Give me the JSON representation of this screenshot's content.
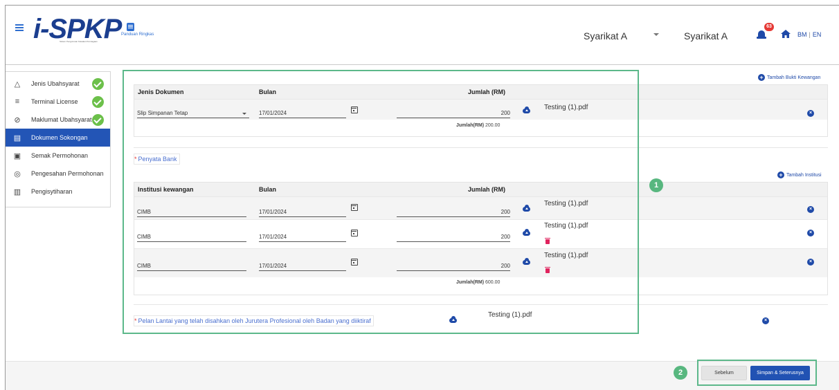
{
  "header": {
    "logo_text": "i-SPKP",
    "logo_subtitle": "Sistem Pengurusan Kawalan Perniagaan",
    "guide_label": "Panduan Ringkas",
    "company_primary": "Syarikat A",
    "company_secondary": "Syarikat A",
    "notification_count": "63",
    "lang_bm": "BM",
    "lang_sep": "|",
    "lang_en": "EN"
  },
  "sidebar": {
    "items": [
      {
        "label": "Jenis Ubahsyarat",
        "icon": "triangle-icon",
        "completed": true
      },
      {
        "label": "Terminal License",
        "icon": "filter-icon",
        "completed": true
      },
      {
        "label": "Maklumat Ubahsyarat",
        "icon": "check-circle-icon",
        "completed": true
      },
      {
        "label": "Dokumen Sokongan",
        "icon": "document-icon",
        "active": true
      },
      {
        "label": "Semak Permohonan",
        "icon": "review-icon"
      },
      {
        "label": "Pengesahan Permohonan",
        "icon": "verify-icon"
      },
      {
        "label": "Pengisytiharan",
        "icon": "clipboard-icon"
      }
    ]
  },
  "financial": {
    "add_label": "Tambah Bukti Kewangan",
    "headers": {
      "doc_type": "Jenis Dokumen",
      "month": "Bulan",
      "amount": "Jumlah (RM)"
    },
    "rows": [
      {
        "doc_type": "Slip Simpanan Tetap",
        "month": "17/01/2024",
        "amount": "200",
        "file": "Testing (1).pdf"
      }
    ],
    "total_label": "Jumlah(RM)",
    "total_value": "200.00"
  },
  "bank": {
    "section_label": "Penyata Bank",
    "add_label": "Tambah Institusi",
    "headers": {
      "institution": "Institusi kewangan",
      "month": "Bulan",
      "amount": "Jumlah (RM)"
    },
    "rows": [
      {
        "institution": "CIMB",
        "month": "17/01/2024",
        "amount": "200",
        "file": "Testing (1).pdf"
      },
      {
        "institution": "CIMB",
        "month": "17/01/2024",
        "amount": "200",
        "file": "Testing (1).pdf"
      },
      {
        "institution": "CIMB",
        "month": "17/01/2024",
        "amount": "200",
        "file": "Testing (1).pdf"
      }
    ],
    "total_label": "Jumlah(RM)",
    "total_value": "600.00"
  },
  "floor_plan": {
    "label": "Pelan Lantai yang telah disahkan oleh Jurutera Profesional oleh Badan yang diiktiraf",
    "file": "Testing (1).pdf"
  },
  "callouts": {
    "one": "1",
    "two": "2"
  },
  "footer": {
    "prev_label": "Sebelum",
    "next_label": "Simpan & Seterusnya"
  },
  "colors": {
    "accent": "#2355b6",
    "success": "#6cc04a",
    "highlight": "#5cb88a",
    "danger": "#e0245e"
  }
}
